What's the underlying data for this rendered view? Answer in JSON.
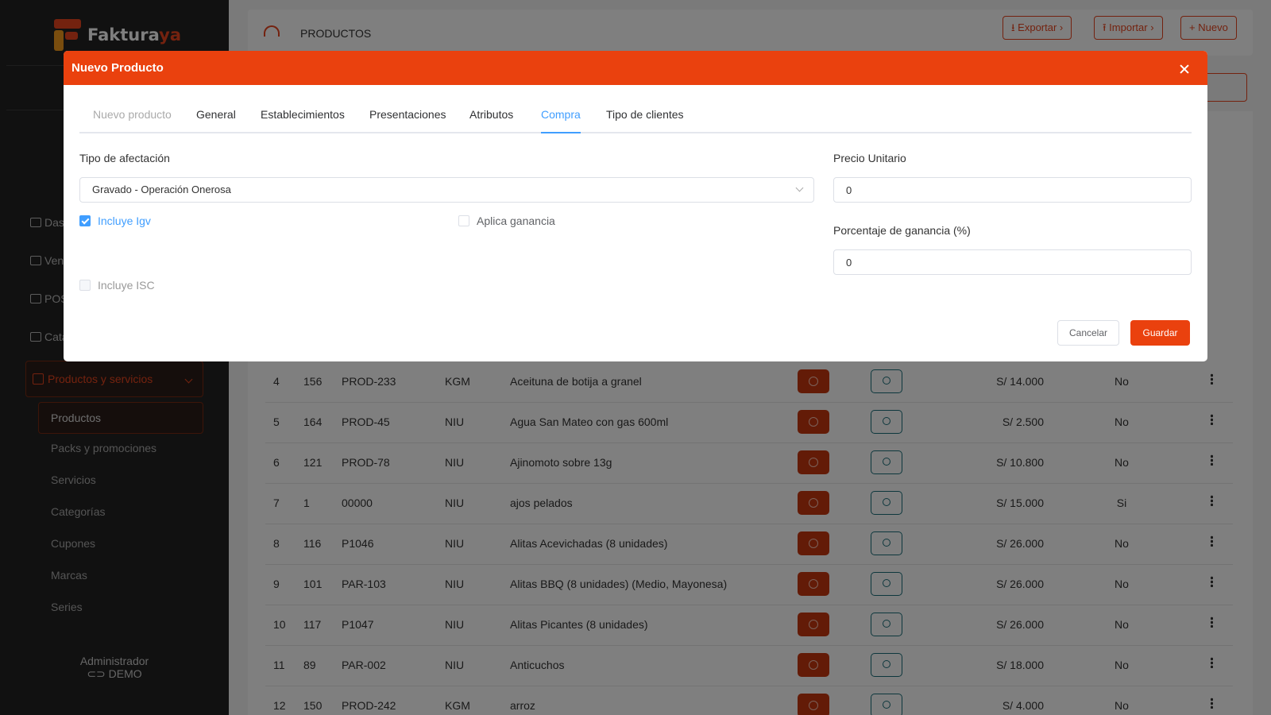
{
  "sidebar": {
    "logo": {
      "part1": "Faktura",
      "part2": "ya"
    },
    "nav": [
      {
        "label": "Das"
      },
      {
        "label": "Ven"
      },
      {
        "label": "POS"
      },
      {
        "label": "Cata"
      }
    ],
    "active_section": "Productos y servicios",
    "submenu": [
      "Productos",
      "Packs y promociones",
      "Servicios",
      "Categorías",
      "Cupones",
      "Marcas",
      "Series"
    ],
    "user_role": "Administrador",
    "user_name": "DEMO"
  },
  "topbar": {
    "title": "PRODUCTOS",
    "export_label": "Exportar",
    "import_label": "Importar",
    "new_label": "Nuevo"
  },
  "table": {
    "rows": [
      {
        "idx": "4",
        "id": "156",
        "code": "PROD-233",
        "unit": "KGM",
        "name": "Aceituna de botija a granel",
        "price": "S/ 14.000",
        "flag": "No"
      },
      {
        "idx": "5",
        "id": "164",
        "code": "PROD-45",
        "unit": "NIU",
        "name": "Agua San Mateo con gas 600ml",
        "price": "S/ 2.500",
        "flag": "No"
      },
      {
        "idx": "6",
        "id": "121",
        "code": "PROD-78",
        "unit": "NIU",
        "name": "Ajinomoto sobre 13g",
        "price": "S/ 10.800",
        "flag": "No"
      },
      {
        "idx": "7",
        "id": "1",
        "code": "00000",
        "unit": "NIU",
        "name": "ajos pelados",
        "price": "S/ 15.000",
        "flag": "Si"
      },
      {
        "idx": "8",
        "id": "116",
        "code": "P1046",
        "unit": "NIU",
        "name": "Alitas Acevichadas (8 unidades)",
        "price": "S/ 26.000",
        "flag": "No"
      },
      {
        "idx": "9",
        "id": "101",
        "code": "PAR-103",
        "unit": "NIU",
        "name": "Alitas BBQ (8 unidades) (Medio, Mayonesa)",
        "price": "S/ 26.000",
        "flag": "No"
      },
      {
        "idx": "10",
        "id": "117",
        "code": "P1047",
        "unit": "NIU",
        "name": "Alitas Picantes (8 unidades)",
        "price": "S/ 26.000",
        "flag": "No"
      },
      {
        "idx": "11",
        "id": "89",
        "code": "PAR-002",
        "unit": "NIU",
        "name": "Anticuchos",
        "price": "S/ 18.000",
        "flag": "No"
      },
      {
        "idx": "12",
        "id": "150",
        "code": "PROD-242",
        "unit": "KGM",
        "name": "arroz",
        "price": "S/ 4.000",
        "flag": "No"
      }
    ]
  },
  "modal": {
    "title": "Nuevo Producto",
    "tabs": [
      "Nuevo producto",
      "General",
      "Establecimientos",
      "Presentaciones",
      "Atributos",
      "Compra",
      "Tipo de clientes"
    ],
    "active_tab": "Compra",
    "tipo_afectacion_label": "Tipo de afectación",
    "tipo_afectacion_value": "Gravado - Operación Onerosa",
    "incluye_igv_label": "Incluye Igv",
    "incluye_igv_checked": true,
    "aplica_ganancia_label": "Aplica ganancia",
    "aplica_ganancia_checked": false,
    "incluye_isc_label": "Incluye ISC",
    "incluye_isc_checked": false,
    "precio_unitario_label": "Precio Unitario",
    "precio_unitario_value": "0",
    "porcentaje_label": "Porcentaje de ganancia (%)",
    "porcentaje_value": "0",
    "cancel_label": "Cancelar",
    "save_label": "Guardar"
  },
  "colors": {
    "accent": "#ea410e",
    "tab_active": "#409eff",
    "sidebar_bg": "#232323"
  }
}
